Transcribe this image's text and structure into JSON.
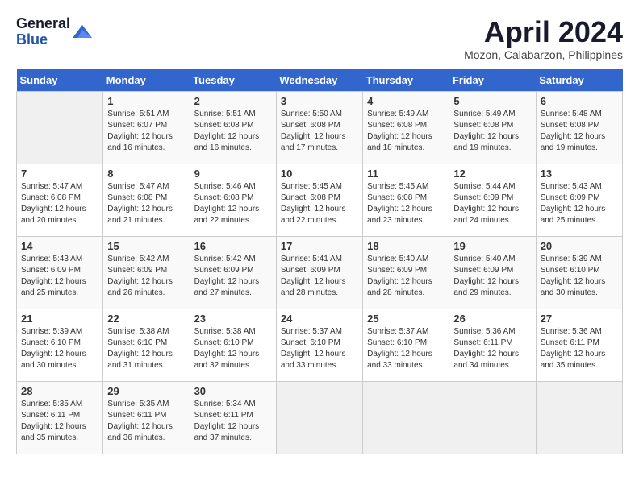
{
  "header": {
    "logo_general": "General",
    "logo_blue": "Blue",
    "month_title": "April 2024",
    "location": "Mozon, Calabarzon, Philippines"
  },
  "calendar": {
    "days_of_week": [
      "Sunday",
      "Monday",
      "Tuesday",
      "Wednesday",
      "Thursday",
      "Friday",
      "Saturday"
    ],
    "weeks": [
      [
        {
          "day": "",
          "info": ""
        },
        {
          "day": "1",
          "info": "Sunrise: 5:51 AM\nSunset: 6:07 PM\nDaylight: 12 hours and 16 minutes."
        },
        {
          "day": "2",
          "info": "Sunrise: 5:51 AM\nSunset: 6:08 PM\nDaylight: 12 hours and 16 minutes."
        },
        {
          "day": "3",
          "info": "Sunrise: 5:50 AM\nSunset: 6:08 PM\nDaylight: 12 hours and 17 minutes."
        },
        {
          "day": "4",
          "info": "Sunrise: 5:49 AM\nSunset: 6:08 PM\nDaylight: 12 hours and 18 minutes."
        },
        {
          "day": "5",
          "info": "Sunrise: 5:49 AM\nSunset: 6:08 PM\nDaylight: 12 hours and 19 minutes."
        },
        {
          "day": "6",
          "info": "Sunrise: 5:48 AM\nSunset: 6:08 PM\nDaylight: 12 hours and 19 minutes."
        }
      ],
      [
        {
          "day": "7",
          "info": "Sunrise: 5:47 AM\nSunset: 6:08 PM\nDaylight: 12 hours and 20 minutes."
        },
        {
          "day": "8",
          "info": "Sunrise: 5:47 AM\nSunset: 6:08 PM\nDaylight: 12 hours and 21 minutes."
        },
        {
          "day": "9",
          "info": "Sunrise: 5:46 AM\nSunset: 6:08 PM\nDaylight: 12 hours and 22 minutes."
        },
        {
          "day": "10",
          "info": "Sunrise: 5:45 AM\nSunset: 6:08 PM\nDaylight: 12 hours and 22 minutes."
        },
        {
          "day": "11",
          "info": "Sunrise: 5:45 AM\nSunset: 6:08 PM\nDaylight: 12 hours and 23 minutes."
        },
        {
          "day": "12",
          "info": "Sunrise: 5:44 AM\nSunset: 6:09 PM\nDaylight: 12 hours and 24 minutes."
        },
        {
          "day": "13",
          "info": "Sunrise: 5:43 AM\nSunset: 6:09 PM\nDaylight: 12 hours and 25 minutes."
        }
      ],
      [
        {
          "day": "14",
          "info": "Sunrise: 5:43 AM\nSunset: 6:09 PM\nDaylight: 12 hours and 25 minutes."
        },
        {
          "day": "15",
          "info": "Sunrise: 5:42 AM\nSunset: 6:09 PM\nDaylight: 12 hours and 26 minutes."
        },
        {
          "day": "16",
          "info": "Sunrise: 5:42 AM\nSunset: 6:09 PM\nDaylight: 12 hours and 27 minutes."
        },
        {
          "day": "17",
          "info": "Sunrise: 5:41 AM\nSunset: 6:09 PM\nDaylight: 12 hours and 28 minutes."
        },
        {
          "day": "18",
          "info": "Sunrise: 5:40 AM\nSunset: 6:09 PM\nDaylight: 12 hours and 28 minutes."
        },
        {
          "day": "19",
          "info": "Sunrise: 5:40 AM\nSunset: 6:09 PM\nDaylight: 12 hours and 29 minutes."
        },
        {
          "day": "20",
          "info": "Sunrise: 5:39 AM\nSunset: 6:10 PM\nDaylight: 12 hours and 30 minutes."
        }
      ],
      [
        {
          "day": "21",
          "info": "Sunrise: 5:39 AM\nSunset: 6:10 PM\nDaylight: 12 hours and 30 minutes."
        },
        {
          "day": "22",
          "info": "Sunrise: 5:38 AM\nSunset: 6:10 PM\nDaylight: 12 hours and 31 minutes."
        },
        {
          "day": "23",
          "info": "Sunrise: 5:38 AM\nSunset: 6:10 PM\nDaylight: 12 hours and 32 minutes."
        },
        {
          "day": "24",
          "info": "Sunrise: 5:37 AM\nSunset: 6:10 PM\nDaylight: 12 hours and 33 minutes."
        },
        {
          "day": "25",
          "info": "Sunrise: 5:37 AM\nSunset: 6:10 PM\nDaylight: 12 hours and 33 minutes."
        },
        {
          "day": "26",
          "info": "Sunrise: 5:36 AM\nSunset: 6:11 PM\nDaylight: 12 hours and 34 minutes."
        },
        {
          "day": "27",
          "info": "Sunrise: 5:36 AM\nSunset: 6:11 PM\nDaylight: 12 hours and 35 minutes."
        }
      ],
      [
        {
          "day": "28",
          "info": "Sunrise: 5:35 AM\nSunset: 6:11 PM\nDaylight: 12 hours and 35 minutes."
        },
        {
          "day": "29",
          "info": "Sunrise: 5:35 AM\nSunset: 6:11 PM\nDaylight: 12 hours and 36 minutes."
        },
        {
          "day": "30",
          "info": "Sunrise: 5:34 AM\nSunset: 6:11 PM\nDaylight: 12 hours and 37 minutes."
        },
        {
          "day": "",
          "info": ""
        },
        {
          "day": "",
          "info": ""
        },
        {
          "day": "",
          "info": ""
        },
        {
          "day": "",
          "info": ""
        }
      ]
    ]
  }
}
